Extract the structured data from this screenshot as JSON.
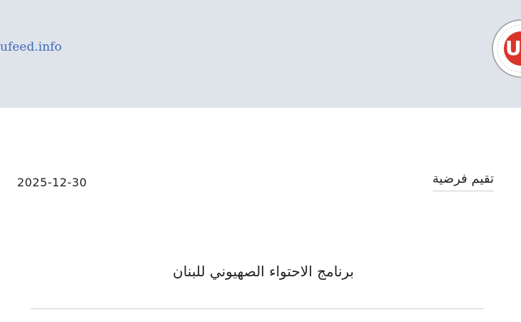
{
  "header": {
    "site_url": "ufeed.info",
    "logo_letter": "U",
    "logo_color": "#d9362b"
  },
  "article": {
    "category": "تقيم فرضية",
    "date": "2025-12-30",
    "title": "برنامج الاحتواء الصهيوني للبنان"
  },
  "colors": {
    "header_bg": "#dfe3ea",
    "link": "#3d6db8"
  }
}
